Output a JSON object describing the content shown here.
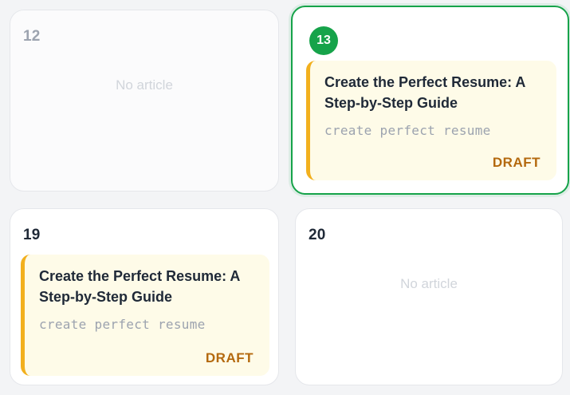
{
  "calendar": {
    "cells": [
      {
        "day": "12",
        "empty_label": "No article"
      },
      {
        "day": "13",
        "article": {
          "title": "Create the Perfect Resume: A Step-by-Step Guide",
          "slug": "create perfect resume",
          "status": "DRAFT"
        }
      },
      {
        "day": "19",
        "article": {
          "title": "Create the Perfect Resume: A Step-by-Step Guide",
          "slug": "create perfect resume",
          "status": "DRAFT"
        }
      },
      {
        "day": "20",
        "empty_label": "No article"
      }
    ]
  },
  "colors": {
    "today_accent": "#16a34a",
    "article_border": "#f2b01e",
    "article_background": "#fefbe8",
    "draft_status": "#b4690e"
  }
}
